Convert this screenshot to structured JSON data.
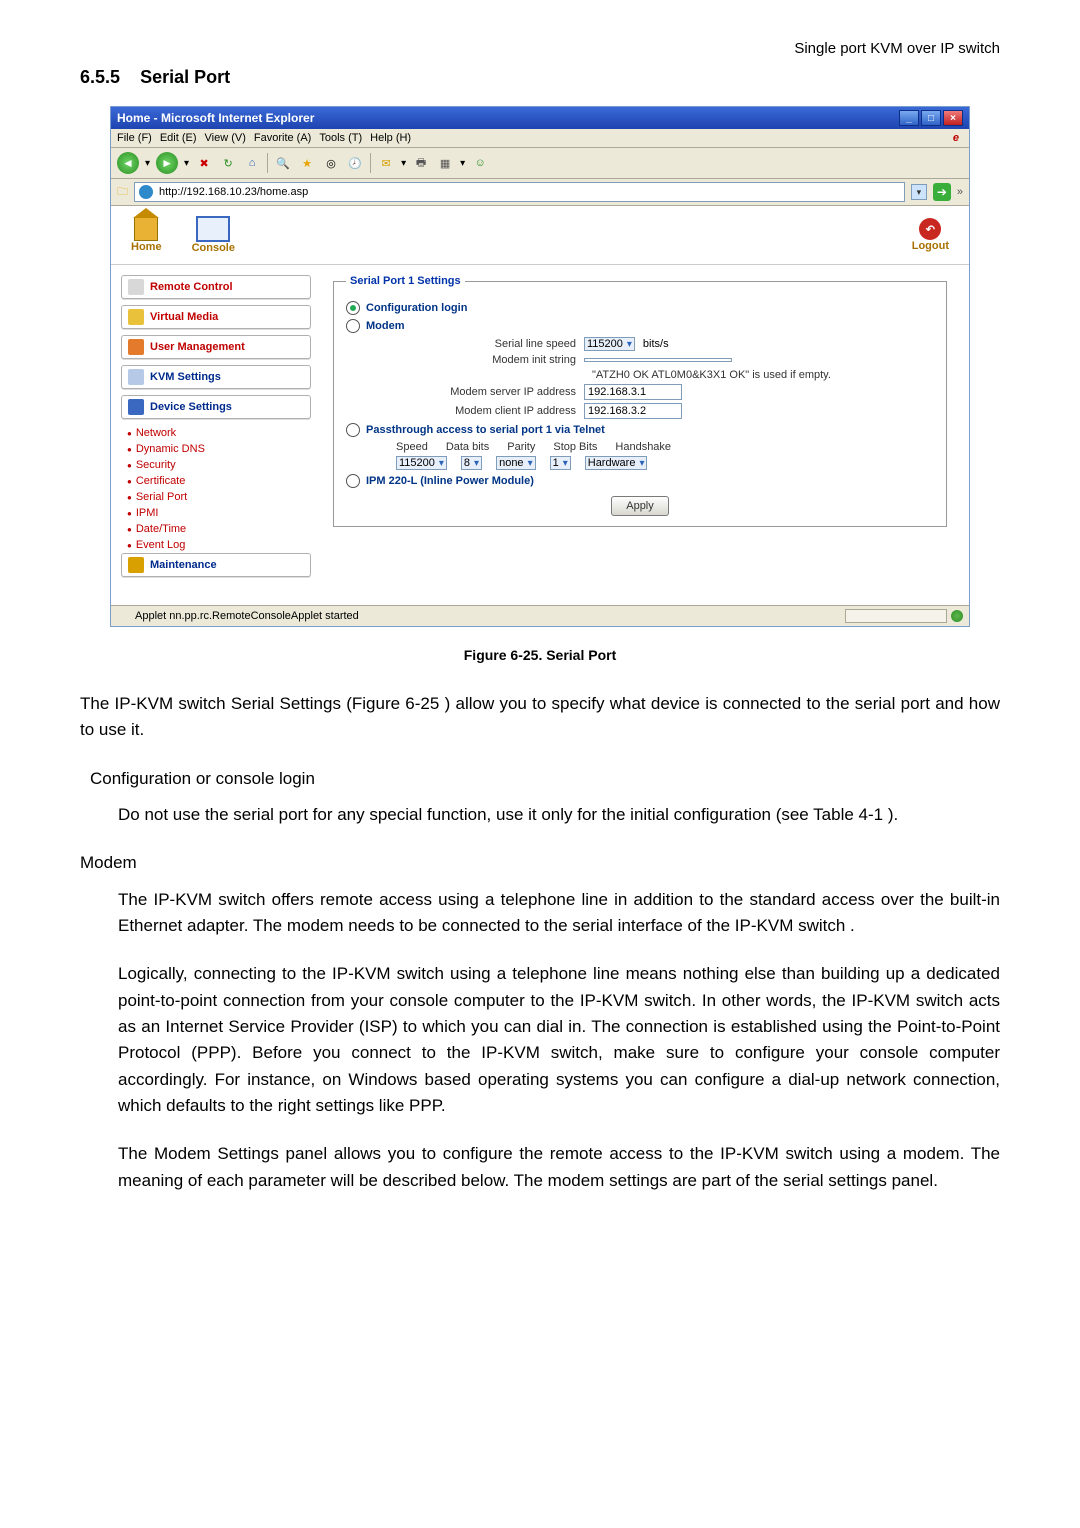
{
  "doc_header": "Single port KVM over IP switch",
  "section_num": "6.5.5",
  "section_title": "Serial Port",
  "browser": {
    "title": "Home - Microsoft Internet Explorer",
    "menu": {
      "file": "File (F)",
      "edit": "Edit (E)",
      "view": "View (V)",
      "favorite": "Favorite (A)",
      "tools": "Tools (T)",
      "help": "Help (H)"
    },
    "url": "http://192.168.10.23/home.asp",
    "status": "Applet nn.pp.rc.RemoteConsoleApplet started"
  },
  "topbar": {
    "home": "Home",
    "console": "Console",
    "logout": "Logout"
  },
  "sidebar": {
    "remote_control": "Remote Control",
    "virtual_media": "Virtual Media",
    "user_mgmt": "User Management",
    "kvm": "KVM Settings",
    "device": "Device Settings",
    "subs": {
      "network": "Network",
      "ddns": "Dynamic DNS",
      "security": "Security",
      "certificate": "Certificate",
      "serial": "Serial Port",
      "ipmi": "IPMI",
      "datetime": "Date/Time",
      "eventlog": "Event Log"
    },
    "maint": "Maintenance"
  },
  "panel": {
    "legend": "Serial Port 1 Settings",
    "opt_conf": "Configuration login",
    "opt_modem": "Modem",
    "line_speed_label": "Serial line speed",
    "line_speed_val": "115200",
    "line_speed_unit": "bits/s",
    "init_label": "Modem init string",
    "init_val": "",
    "init_hint": "\"ATZH0 OK ATL0M0&K3X1 OK\" is used if empty.",
    "server_ip_label": "Modem server IP address",
    "server_ip_val": "192.168.3.1",
    "client_ip_label": "Modem client IP address",
    "client_ip_val": "192.168.3.2",
    "opt_pass": "Passthrough access to serial port 1 via Telnet",
    "pt": {
      "speed_h": "Speed",
      "databits_h": "Data bits",
      "parity_h": "Parity",
      "stopbits_h": "Stop Bits",
      "handshake_h": "Handshake",
      "speed_v": "115200",
      "databits_v": "8",
      "parity_v": "none",
      "stopbits_v": "1",
      "handshake_v": "Hardware"
    },
    "opt_ipm": "IPM 220-L (Inline Power Module)",
    "apply": "Apply"
  },
  "caption": "Figure 6-25. Serial Port",
  "text": {
    "p1": "The IP-KVM switch Serial Settings (Figure 6-25 ) allow you to specify what device is connected to the serial port and how to use it.",
    "conf_head": "Configuration or console login",
    "conf_body": "Do not use the serial port for any special function, use it only for the initial configuration (see Table 4-1 ).",
    "modem_head": "Modem",
    "m1": "The IP-KVM switch offers remote access using a telephone line in addition to the standard access over the built-in Ethernet adapter. The modem needs to be connected to the serial interface of the IP-KVM switch .",
    "m2": "Logically, connecting to the IP-KVM switch using a telephone line means nothing else than building up a dedicated point-to-point connection from your console computer to the IP-KVM switch. In other words, the IP-KVM switch acts as an Internet Service Provider (ISP) to which you can dial in. The connection is established using the Point-to-Point Protocol (PPP). Before you connect to the IP-KVM switch, make sure to configure your console computer accordingly. For instance, on Windows based operating systems you can configure a dial-up network connection, which defaults to the right settings like PPP.",
    "m3": "The Modem Settings panel allows you to configure the remote access to the IP-KVM switch using a modem. The meaning of each parameter will be described below. The modem settings are part of the serial settings panel."
  }
}
